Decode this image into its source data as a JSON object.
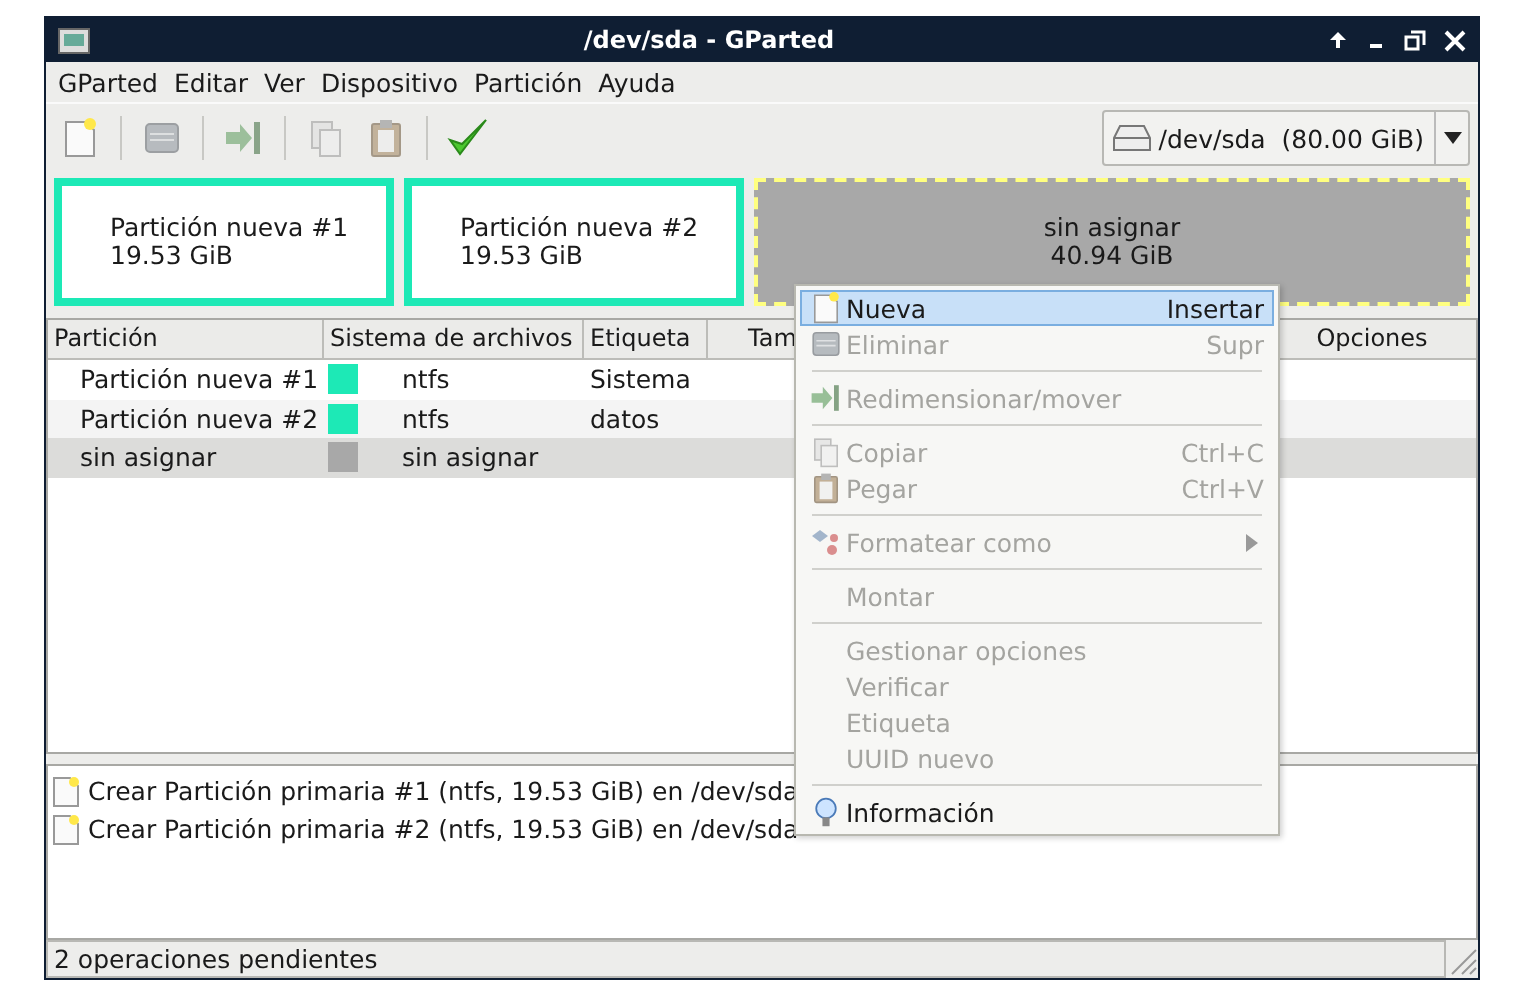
{
  "window": {
    "title": "/dev/sda - GParted"
  },
  "menubar": [
    "GParted",
    "Editar",
    "Ver",
    "Dispositivo",
    "Partición",
    "Ayuda"
  ],
  "toolbar": [
    {
      "kind": "new",
      "disabled": false
    },
    {
      "kind": "delete",
      "disabled": true
    },
    {
      "kind": "resize",
      "disabled": true
    },
    {
      "kind": "copy",
      "disabled": true
    },
    {
      "kind": "paste",
      "disabled": true
    },
    {
      "kind": "apply",
      "disabled": false
    }
  ],
  "device": {
    "value": "/dev/sda  (80.00 GiB)"
  },
  "disk_map": [
    {
      "kind": "partition",
      "name": "Partición nueva #1",
      "size": "19.53 GiB",
      "color": "#1de9b6",
      "selected": false
    },
    {
      "kind": "partition",
      "name": "Partición nueva #2",
      "size": "19.53 GiB",
      "color": "#1de9b6",
      "selected": false
    },
    {
      "kind": "unallocated",
      "name": "sin asignar",
      "size": "40.94 GiB",
      "color": "#a8a8a8",
      "selected": true
    }
  ],
  "table": {
    "columns": [
      "Partición",
      "Sistema de archivos",
      "Etiqueta",
      "Tam",
      "Opciones"
    ],
    "rows": [
      {
        "partition": "Partición nueva #1",
        "color": "#1de9b6",
        "filesystem": "ntfs",
        "label": "Sistema",
        "selected": false
      },
      {
        "partition": "Partición nueva #2",
        "color": "#1de9b6",
        "filesystem": "ntfs",
        "label": "datos",
        "selected": false
      },
      {
        "partition": "sin asignar",
        "color": "#a8a8a8",
        "filesystem": "sin asignar",
        "label": "",
        "selected": true
      }
    ]
  },
  "context_menu": [
    {
      "kind": "new",
      "label": "Nueva",
      "shortcut": "Insertar",
      "disabled": false,
      "selected": true
    },
    {
      "kind": "delete",
      "label": "Eliminar",
      "shortcut": "Supr",
      "disabled": true,
      "selected": false
    },
    {
      "kind": "separator"
    },
    {
      "kind": "resize",
      "label": "Redimensionar/mover",
      "disabled": true,
      "selected": false
    },
    {
      "kind": "separator"
    },
    {
      "kind": "copy",
      "label": "Copiar",
      "shortcut": "Ctrl+C",
      "disabled": true,
      "selected": false
    },
    {
      "kind": "paste",
      "label": "Pegar",
      "shortcut": "Ctrl+V",
      "disabled": true,
      "selected": false
    },
    {
      "kind": "separator"
    },
    {
      "kind": "format",
      "label": "Formatear como",
      "disabled": true,
      "selected": false
    },
    {
      "kind": "separator"
    },
    {
      "kind": "plain",
      "label": "Montar",
      "disabled": true,
      "selected": false
    },
    {
      "kind": "separator"
    },
    {
      "kind": "plain",
      "label": "Gestionar opciones",
      "disabled": true,
      "selected": false
    },
    {
      "kind": "plain",
      "label": "Verificar",
      "disabled": true,
      "selected": false
    },
    {
      "kind": "plain",
      "label": "Etiqueta",
      "disabled": true,
      "selected": false
    },
    {
      "kind": "plain",
      "label": "UUID nuevo",
      "disabled": true,
      "selected": false
    },
    {
      "kind": "separator"
    },
    {
      "kind": "info",
      "label": "Información",
      "disabled": false,
      "selected": false
    }
  ],
  "operations": [
    "Crear Partición primaria #1 (ntfs, 19.53 GiB) en /dev/sda",
    "Crear Partición primaria #2 (ntfs, 19.53 GiB) en /dev/sda"
  ],
  "status_bar": "2 operaciones pendientes"
}
